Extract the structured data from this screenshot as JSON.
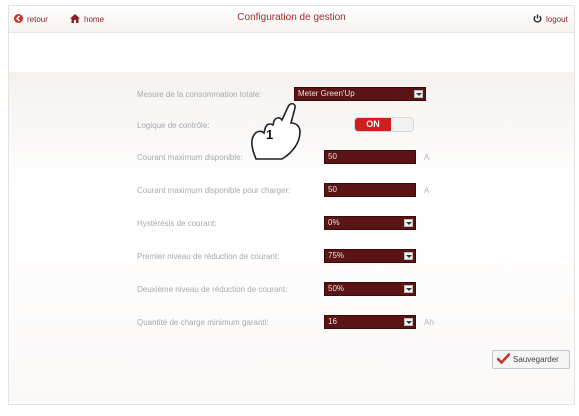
{
  "header": {
    "back_label": "retour",
    "home_label": "home",
    "title": "Configuration de gestion",
    "logout_label": "logout"
  },
  "form": {
    "consumption_label": "Mesure de la consommation totale:",
    "consumption_value": "Meter Green'Up",
    "logic_label": "Logique de contrôle:",
    "logic_value": "ON",
    "max_current_label": "Courant maximum disponible:",
    "max_current_value": "50",
    "max_current_unit": "A",
    "max_charge_current_label": "Courant maximum disponible pour charger:",
    "max_charge_current_value": "50",
    "max_charge_current_unit": "A",
    "hysteresis_label": "Hystérésis de courant:",
    "hysteresis_value": "0%",
    "first_reduction_label": "Premier niveau de réduction de courant:",
    "first_reduction_value": "75%",
    "second_reduction_label": "Deuxième niveau de réduction de courant:",
    "second_reduction_value": "50%",
    "min_charge_label": "Quantité de charge minimum garanti:",
    "min_charge_value": "16",
    "min_charge_unit": "Ah"
  },
  "actions": {
    "save_label": "Sauvegarder"
  },
  "annotation": {
    "callout_number": "1"
  },
  "colors": {
    "field_bg": "#5a1414",
    "accent_red": "#cf1e1e",
    "title_red": "#a52a2a"
  }
}
